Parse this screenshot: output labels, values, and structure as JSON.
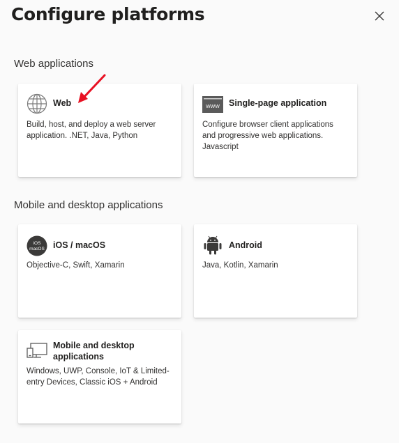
{
  "title": "Configure platforms",
  "sections": {
    "web": {
      "label": "Web applications"
    },
    "mobile": {
      "label": "Mobile and desktop applications"
    }
  },
  "cards": {
    "web": {
      "name": "Web",
      "desc": "Build, host, and deploy a web server application. .NET, Java, Python",
      "icon": "globe-icon"
    },
    "spa": {
      "name": "Single-page application",
      "desc": "Configure browser client applications and progressive web applications. Javascript",
      "icon": "www-icon",
      "icon_text": "WWW"
    },
    "ios": {
      "name": "iOS / macOS",
      "desc": "Objective-C, Swift, Xamarin",
      "icon": "ios-macos-icon",
      "icon_text_1": "iOS",
      "icon_text_2": "macOS"
    },
    "android": {
      "name": "Android",
      "desc": "Java, Kotlin, Xamarin",
      "icon": "android-icon"
    },
    "desktop": {
      "name": "Mobile and desktop applications",
      "desc": "Windows, UWP, Console, IoT & Limited-entry Devices, Classic iOS + Android",
      "icon": "desktop-icon"
    }
  },
  "colors": {
    "accent_arrow": "#e81123",
    "text": "#323130",
    "icon_dark": "#3b3a39"
  }
}
